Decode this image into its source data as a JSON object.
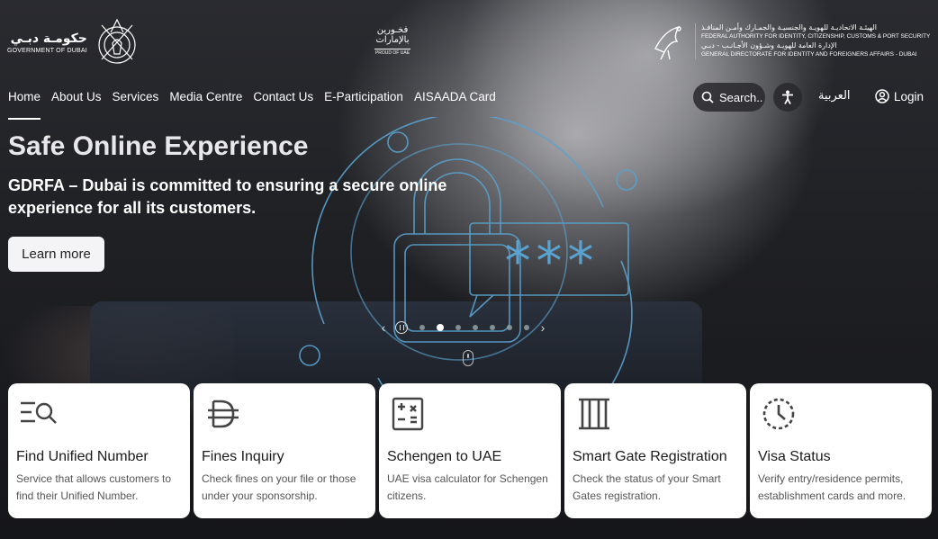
{
  "header": {
    "gov_dubai_ar": "حكومـة دبـي",
    "gov_dubai_en": "GOVERNMENT OF DUBAI",
    "proud_ar_line1": "فخـورين",
    "proud_ar_line2": "بالإمارات",
    "proud_en": "PROUD OF UAE",
    "authority_ar": "الهيئـة الاتحاديـة للهويـة والجنسيـة والجمـارك وأمـن المنافـذ",
    "authority_en": "FEDERAL AUTHORITY FOR IDENTITY, CITIZENSHIP, CUSTOMS & PORT SECURITY",
    "directorate_ar": "الإدارة العامة للهويـة وشـؤون الأجـانـب - دبـي",
    "directorate_en": "GENERAL DIRECTORATE FOR IDENTITY AND FOREIGNERS AFFAIRS - DUBAI"
  },
  "nav": {
    "items": [
      {
        "label": "Home",
        "active": true
      },
      {
        "label": "About Us"
      },
      {
        "label": "Services"
      },
      {
        "label": "Media Centre"
      },
      {
        "label": "Contact Us"
      },
      {
        "label": "E-Participation"
      },
      {
        "label": "AISAADA Card"
      }
    ],
    "search_label": "Search..",
    "language_label": "العربية",
    "login_label": "Login"
  },
  "hero": {
    "title": "Safe Online Experience",
    "subtitle": "GDRFA – Dubai is committed to ensuring a secure online experience for all its customers.",
    "button_label": "Learn more",
    "password_mask": "***",
    "slide_count": 7,
    "active_slide": 1
  },
  "cards": [
    {
      "icon": "search-list-icon",
      "title": "Find Unified Number",
      "desc": "Service that allows customers to find their Unified Number."
    },
    {
      "icon": "dirham-icon",
      "title": "Fines Inquiry",
      "desc": "Check fines on your file or those under your sponsorship."
    },
    {
      "icon": "calculator-icon",
      "title": "Schengen to UAE",
      "desc": "UAE visa calculator for Schengen citizens."
    },
    {
      "icon": "gate-icon",
      "title": "Smart Gate Registration",
      "desc": "Check the status of your Smart Gates registration."
    },
    {
      "icon": "clock-status-icon",
      "title": "Visa Status",
      "desc": "Verify entry/residence permits, establishment cards and more."
    }
  ]
}
